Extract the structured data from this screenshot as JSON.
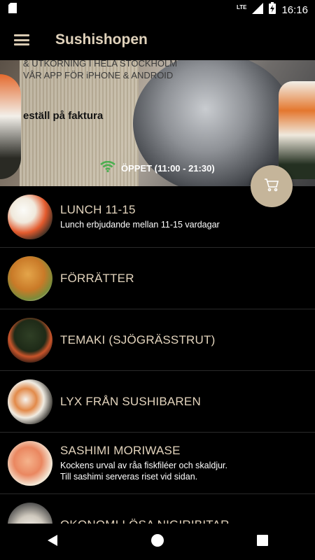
{
  "status_bar": {
    "network": "LTE",
    "time": "16:16",
    "icons": [
      "sd-card-icon",
      "signal-icon",
      "battery-charging-icon"
    ]
  },
  "app_bar": {
    "menu_icon": "hamburger-menu-icon",
    "title": "Sushishopen"
  },
  "banner": {
    "line1": "& UTKÖRNING I HELA STOCKHOLM",
    "line2": "VÅR APP FÖR iPHONE & ANDROID",
    "invoice_text": "eställ på faktura",
    "open_status": "ÖPPET (11:00 - 21:30)",
    "open_icon": "wifi-icon",
    "open_color": "#4caf50"
  },
  "cart_button": {
    "icon": "cart-icon",
    "color": "#c5b59a"
  },
  "menu": {
    "items": [
      {
        "name": "LUNCH 11-15",
        "desc": "Lunch erbjudande mellan 11-15 vardagar"
      },
      {
        "name": "FÖRRÄTTER",
        "desc": ""
      },
      {
        "name": "TEMAKI (SJÖGRÄSSTRUT)",
        "desc": ""
      },
      {
        "name": "LYX FRÅN SUSHIBAREN",
        "desc": ""
      },
      {
        "name": "SASHIMI MORIWASE",
        "desc": "Kockens urval av råa fiskfiléer och skaldjur.",
        "desc2": "Till sashimi serveras riset vid sidan."
      },
      {
        "name": "OKONOMI LÖSA NIGIRIBITAR",
        "desc": ""
      }
    ]
  },
  "nav_bar": {
    "icons": [
      "back-icon",
      "home-icon",
      "recents-icon"
    ]
  },
  "colors": {
    "accent_text": "#e3d4bd",
    "background": "#000000"
  }
}
